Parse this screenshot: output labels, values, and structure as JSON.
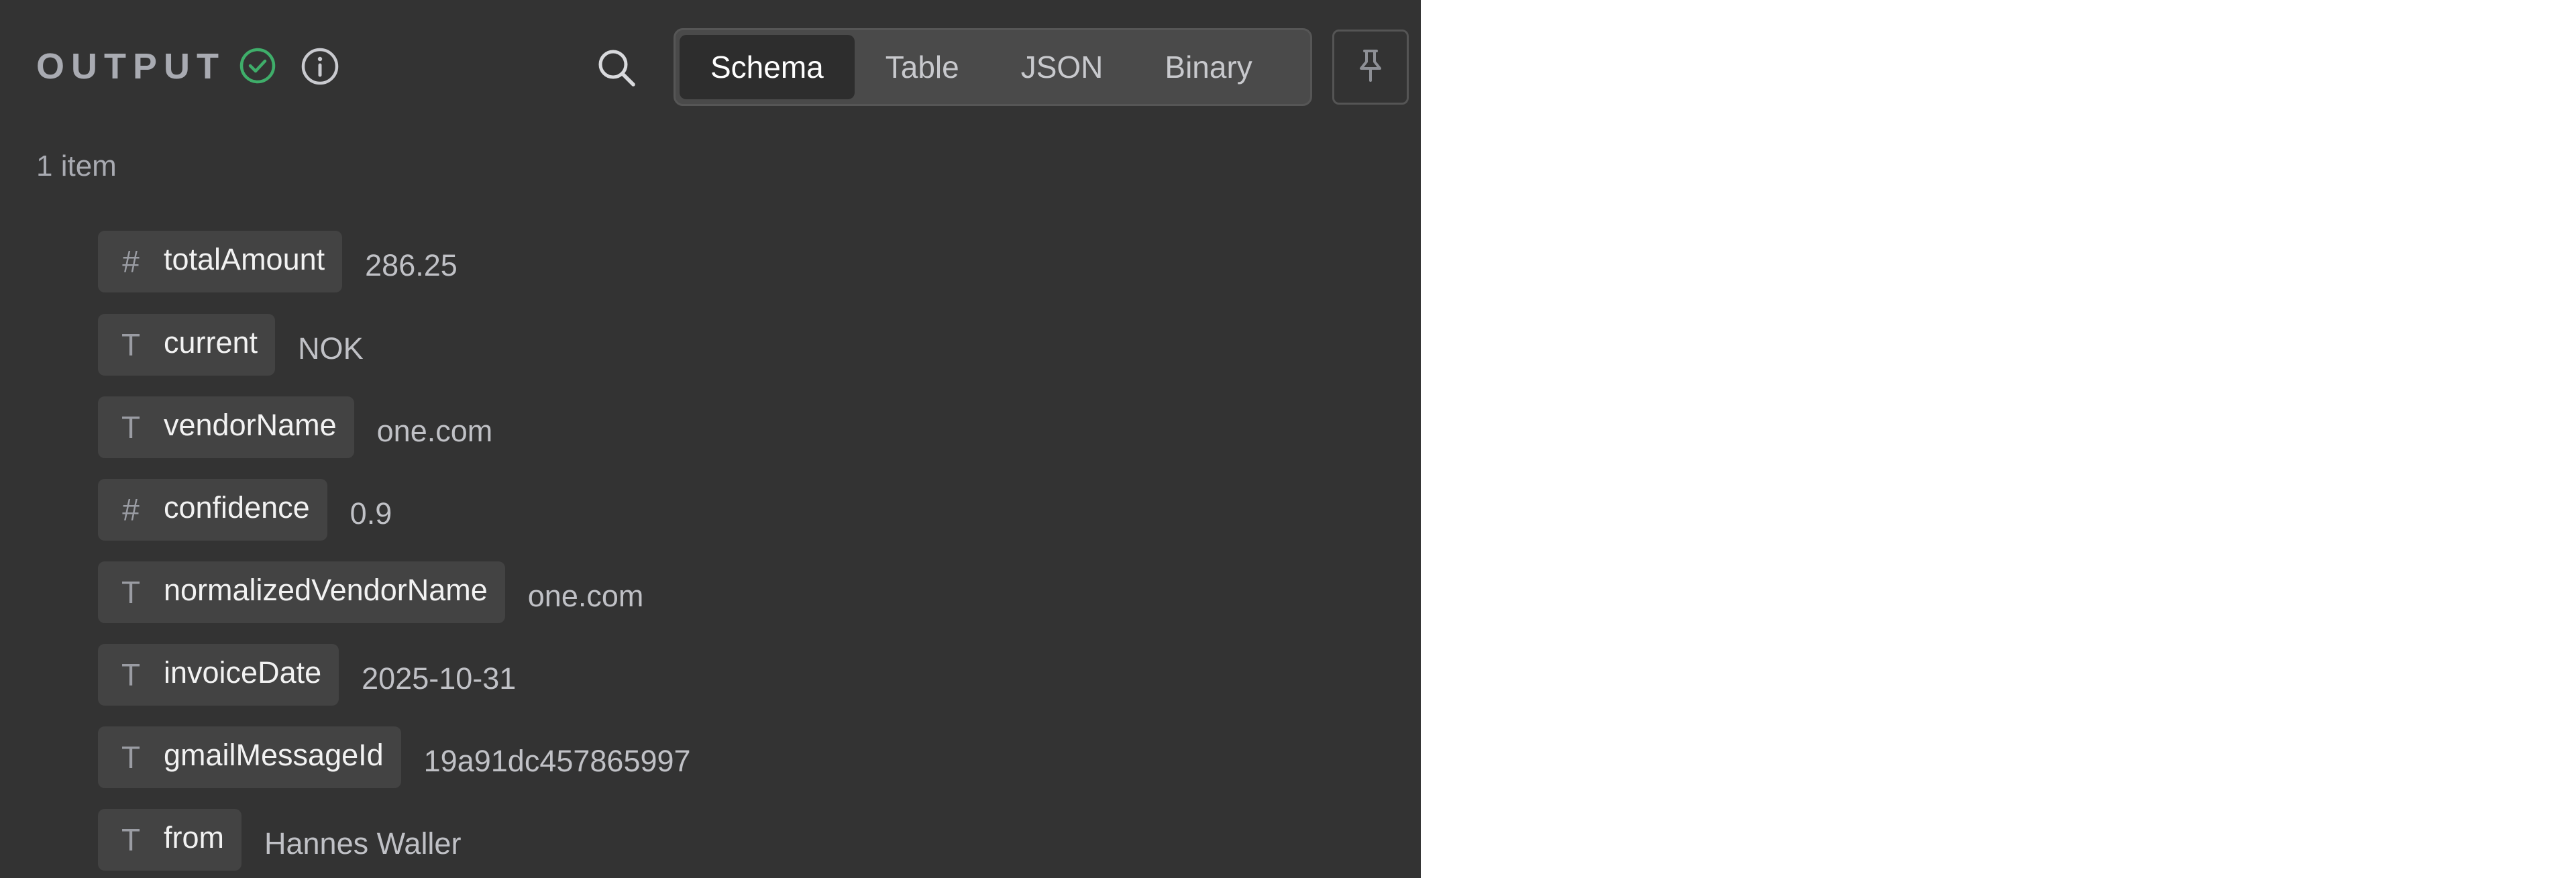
{
  "header": {
    "title": "OUTPUT",
    "status_icon": "check-circle-icon",
    "status_color": "#3fae6a",
    "info_icon": "info-circle-icon",
    "search_icon": "search-icon",
    "pin_icon": "pin-icon"
  },
  "tabs": [
    {
      "label": "Schema",
      "active": true
    },
    {
      "label": "Table",
      "active": false
    },
    {
      "label": "JSON",
      "active": false
    },
    {
      "label": "Binary",
      "active": false
    }
  ],
  "item_count": "1 item",
  "fields": [
    {
      "type": "number",
      "type_glyph": "#",
      "key": "totalAmount",
      "value": "286.25"
    },
    {
      "type": "string",
      "type_glyph": "T",
      "key": "current",
      "value": "NOK"
    },
    {
      "type": "string",
      "type_glyph": "T",
      "key": "vendorName",
      "value": "one.com"
    },
    {
      "type": "number",
      "type_glyph": "#",
      "key": "confidence",
      "value": "0.9"
    },
    {
      "type": "string",
      "type_glyph": "T",
      "key": "normalizedVendorName",
      "value": "one.com"
    },
    {
      "type": "string",
      "type_glyph": "T",
      "key": "invoiceDate",
      "value": "2025-10-31"
    },
    {
      "type": "string",
      "type_glyph": "T",
      "key": "gmailMessageId",
      "value": "19a91dc457865997"
    },
    {
      "type": "string",
      "type_glyph": "T",
      "key": "from",
      "value": "Hannes Waller"
    }
  ],
  "colors": {
    "panel_bg": "#333333",
    "pill_bg": "#434343",
    "active_tab_bg": "#2d2d2d",
    "success": "#3fae6a"
  }
}
